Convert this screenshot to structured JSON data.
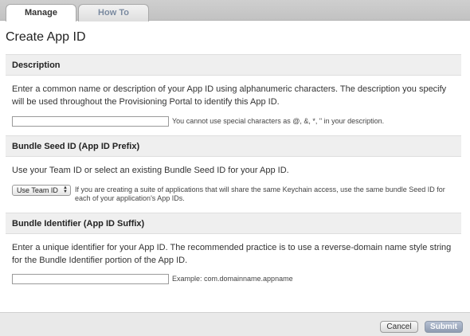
{
  "tabs": [
    {
      "label": "Manage"
    },
    {
      "label": "How To"
    }
  ],
  "page": {
    "title": "Create App ID"
  },
  "description": {
    "header": "Description",
    "text": "Enter a common name or description of your App ID using alphanumeric characters. The description you specify will be used throughout the Provisioning Portal to identify this App ID.",
    "input_value": "",
    "hint": "You cannot use special characters as @, &, *, \" in your description."
  },
  "bundle_seed": {
    "header": "Bundle Seed ID (App ID Prefix)",
    "text": "Use your Team ID or select an existing Bundle Seed ID for your App ID.",
    "select_value": "Use Team ID",
    "hint": "If you are creating a suite of applications that will share the same Keychain access, use the same bundle Seed ID for each of your application's App IDs."
  },
  "bundle_identifier": {
    "header": "Bundle Identifier (App ID Suffix)",
    "text": "Enter a unique identifier for your App ID. The recommended practice is to use a reverse-domain name style string for the Bundle Identifier portion of the App ID.",
    "input_value": "",
    "hint": "Example: com.domainname.appname"
  },
  "footer": {
    "cancel_label": "Cancel",
    "submit_label": "Submit"
  }
}
